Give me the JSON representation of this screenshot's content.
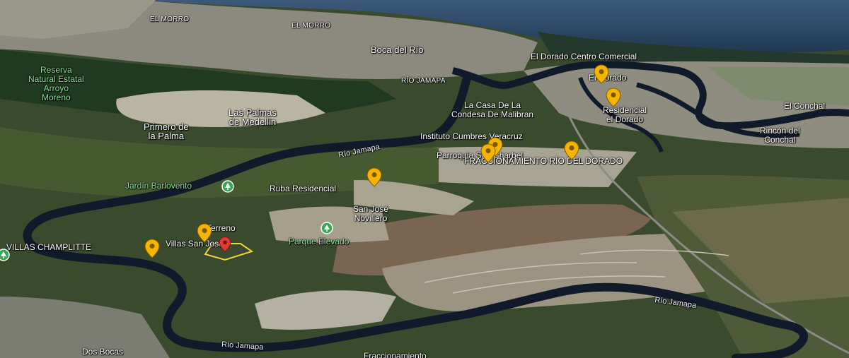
{
  "map": {
    "labels": {
      "el_morro_1": "EL MORRO",
      "el_morro_2": "EL MORRO",
      "boca_del_rio": "Boca del Río",
      "rio_jamapa_top": "RÍO JAMAPA",
      "reserva": "Reserva\nNatural Estatal\nArroyo\nMoreno",
      "el_dorado_cc": "El Dorado Centro Comercial",
      "el_dorado": "El Dorado",
      "residencial_el_dorado": "Residencial\nel Dorado",
      "el_conchal": "El Conchal",
      "rincon_conchal": "Rincón del\nConchal",
      "casa_condesa": "La Casa De La\nCondesa De Malibran",
      "las_palmas": "Las Palmas\nde Medellin",
      "primero_palma": "Primero de\nla Palma",
      "instituto": "Instituto Cumbres Veracruz",
      "parroquia": "Parroquia San Charbel",
      "fraccionamiento_dorado": "FRACCIONAMIENTO RÍO DEL DORADO",
      "jardin": "Jardín Barlovento",
      "ruba": "Ruba Residencial",
      "san_jose": "San José\nNovillero",
      "terreno": "Terreno",
      "villas_champlitte": "VILLAS CHAMPLITTE",
      "villas_san_jose": "Villas San José",
      "parque_elevado": "Parque Elevado",
      "rio_jamapa_mid": "Río Jamapa",
      "rio_jamapa_right": "Río Jamapa",
      "rio_jamapa_bottom": "Río Jamapa",
      "dos_bocas": "Dos Bocas",
      "fraccionamiento_bottom": "Fraccionamiento"
    },
    "colors": {
      "pin_yellow": "#f4b400",
      "pin_red": "#e53935",
      "park_green": "#34a853",
      "river": "#111a2a",
      "sea": "#1f3c5a"
    },
    "icons": [
      "pin-icon",
      "park-icon",
      "location-marker-icon"
    ]
  }
}
